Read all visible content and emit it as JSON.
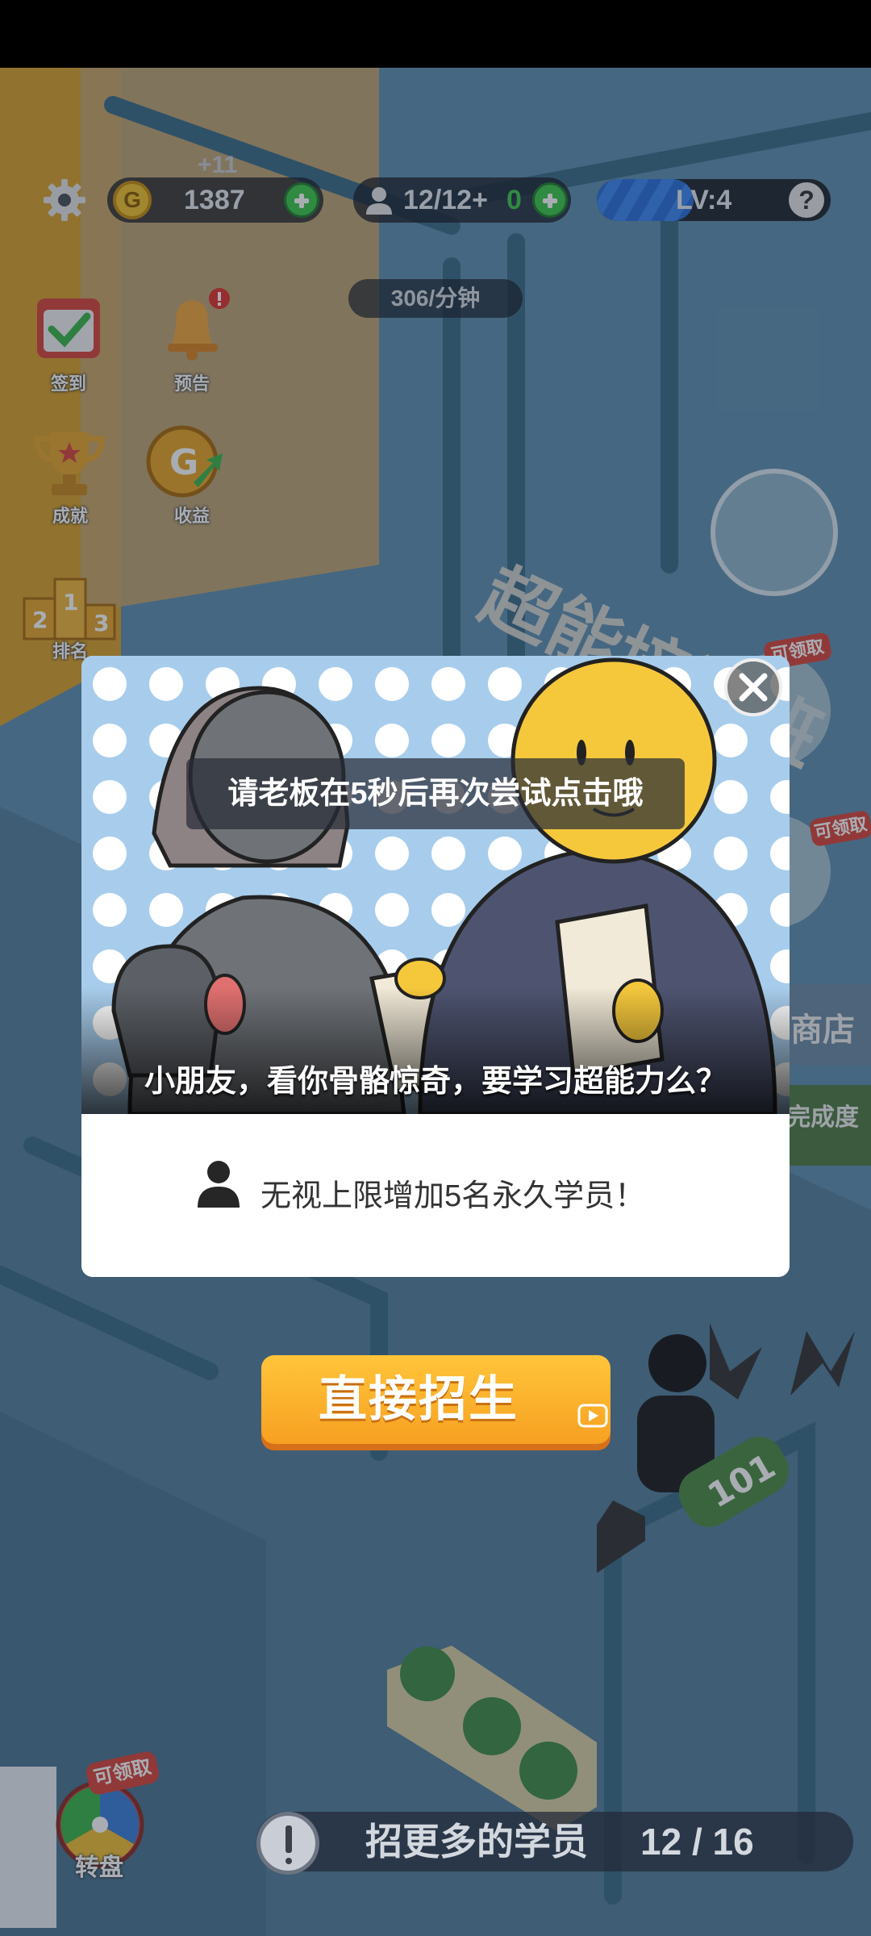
{
  "hud": {
    "coins_gain": "+11",
    "coins": "1387",
    "students": "12/12+",
    "students_bonus": "0",
    "level": "LV:4",
    "rate": "306/分钟"
  },
  "side_menu": {
    "signin": "签到",
    "notice": "预告",
    "achievement": "成就",
    "income": "收益",
    "ranking": "排名",
    "wheel": "转盘",
    "wheel_badge": "可领取"
  },
  "scene": {
    "sign_text": "超能培训班",
    "right_badge_1": "可领取",
    "right_badge_2": "可领取",
    "shop_label": "商店",
    "progress_label": "完成度",
    "room_number": "101"
  },
  "popup": {
    "toast": "请老板在5秒后再次尝试点击哦",
    "caption": "小朋友，看你骨骼惊奇，要学习超能力么？",
    "benefit": "无视上限增加5名永久学员！"
  },
  "recruit_button": {
    "label": "直接招生"
  },
  "task": {
    "text": "招更多的学员",
    "count": "12 / 16"
  },
  "colors": {
    "accent_orange": "#f7a021",
    "hud_green": "#3cc74a",
    "level_blue": "#2b6fd8"
  },
  "icons": [
    "gear-icon",
    "coin-icon",
    "person-icon",
    "plus-icon",
    "help-icon",
    "close-icon",
    "video-ad-icon",
    "alert-icon"
  ]
}
